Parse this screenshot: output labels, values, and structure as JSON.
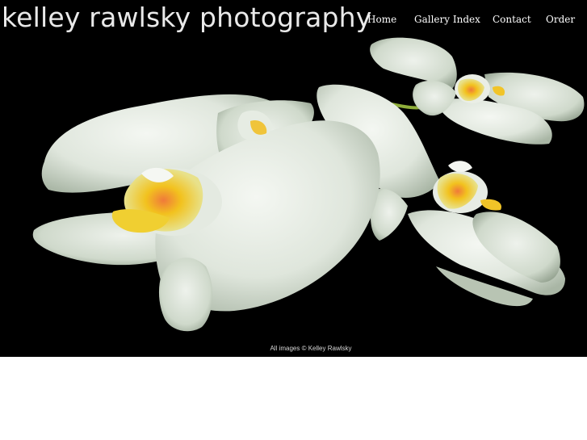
{
  "site": {
    "title": "kelley rawlsky photography"
  },
  "nav": {
    "items": [
      {
        "label": "Home"
      },
      {
        "label": "Gallery Index"
      },
      {
        "label": "Contact"
      },
      {
        "label": "Order"
      }
    ]
  },
  "hero": {
    "image_subject": "white orchid flowers on black background",
    "copyright": "All images © Kelley Rawlsky"
  },
  "colors": {
    "background": "#000000",
    "title_text": "#e9e9e9",
    "nav_text": "#ffffff",
    "page": "#ffffff"
  }
}
